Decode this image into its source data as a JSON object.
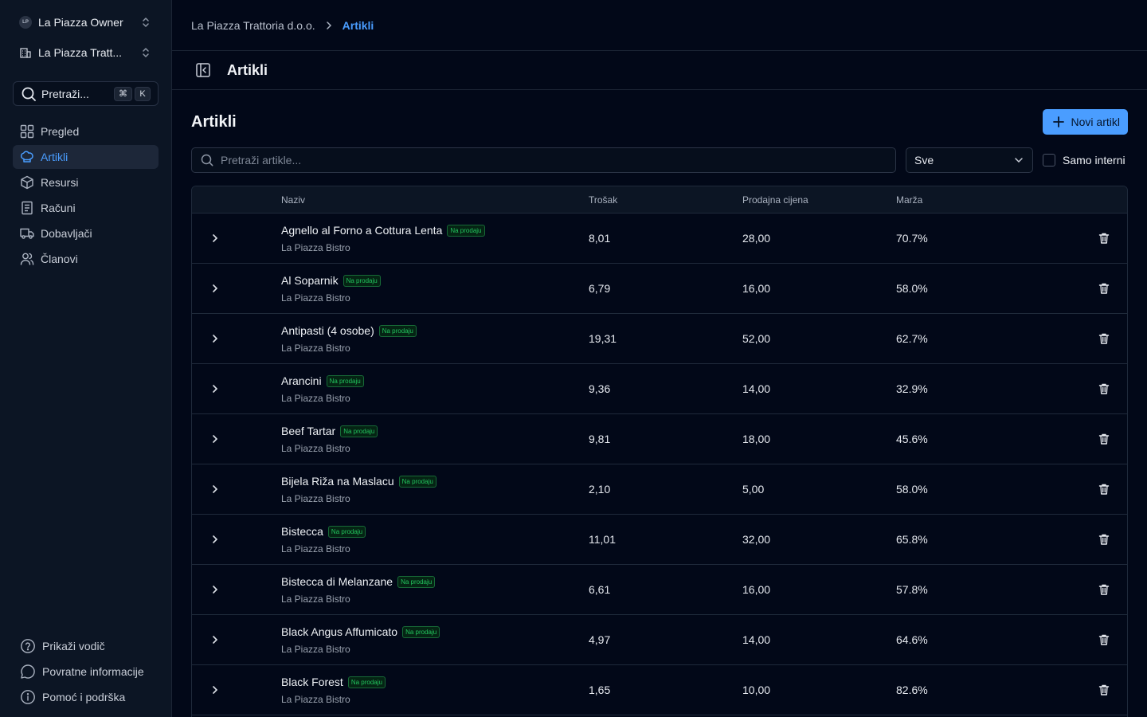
{
  "sidebar": {
    "org_switcher": {
      "badge": "LP",
      "label": "La Piazza Owner"
    },
    "location_switcher": {
      "label": "La Piazza Tratt..."
    },
    "search": {
      "label": "Pretraži...",
      "kbd_modifier": "⌘",
      "kbd_key": "K"
    },
    "nav": [
      {
        "label": "Pregled",
        "icon": "dashboard-icon"
      },
      {
        "label": "Artikli",
        "icon": "chef-hat-icon",
        "active": true
      },
      {
        "label": "Resursi",
        "icon": "box-icon"
      },
      {
        "label": "Računi",
        "icon": "receipt-icon"
      },
      {
        "label": "Dobavljači",
        "icon": "truck-icon"
      },
      {
        "label": "Članovi",
        "icon": "users-icon"
      }
    ],
    "bottom": [
      {
        "label": "Prikaži vodič",
        "icon": "help-circle-icon"
      },
      {
        "label": "Povratne informacije",
        "icon": "message-circle-icon"
      },
      {
        "label": "Pomoć i podrška",
        "icon": "info-icon"
      }
    ]
  },
  "breadcrumb": {
    "parent": "La Piazza Trattoria d.o.o.",
    "current": "Artikli"
  },
  "header": {
    "title": "Artikli"
  },
  "page": {
    "heading": "Artikli",
    "new_button": "Novi artikl",
    "search_placeholder": "Pretraži artikle...",
    "filter_value": "Sve",
    "internal_label": "Samo interni"
  },
  "table": {
    "columns": [
      "Naziv",
      "Trošak",
      "Prodajna cijena",
      "Marža"
    ],
    "rows": [
      {
        "name": "Agnello al Forno a Cottura Lenta",
        "badge": "Na prodaju",
        "location": "La Piazza Bistro",
        "cost": "8,01",
        "price": "28,00",
        "margin": "70.7%"
      },
      {
        "name": "Al Soparnik",
        "badge": "Na prodaju",
        "location": "La Piazza Bistro",
        "cost": "6,79",
        "price": "16,00",
        "margin": "58.0%"
      },
      {
        "name": "Antipasti (4 osobe)",
        "badge": "Na prodaju",
        "location": "La Piazza Bistro",
        "cost": "19,31",
        "price": "52,00",
        "margin": "62.7%"
      },
      {
        "name": "Arancini",
        "badge": "Na prodaju",
        "location": "La Piazza Bistro",
        "cost": "9,36",
        "price": "14,00",
        "margin": "32.9%"
      },
      {
        "name": "Beef Tartar",
        "badge": "Na prodaju",
        "location": "La Piazza Bistro",
        "cost": "9,81",
        "price": "18,00",
        "margin": "45.6%"
      },
      {
        "name": "Bijela Riža na Maslacu",
        "badge": "Na prodaju",
        "location": "La Piazza Bistro",
        "cost": "2,10",
        "price": "5,00",
        "margin": "58.0%"
      },
      {
        "name": "Bistecca",
        "badge": "Na prodaju",
        "location": "La Piazza Bistro",
        "cost": "11,01",
        "price": "32,00",
        "margin": "65.8%"
      },
      {
        "name": "Bistecca di Melanzane",
        "badge": "Na prodaju",
        "location": "La Piazza Bistro",
        "cost": "6,61",
        "price": "16,00",
        "margin": "57.8%"
      },
      {
        "name": "Black Angus Affumicato",
        "badge": "Na prodaju",
        "location": "La Piazza Bistro",
        "cost": "4,97",
        "price": "14,00",
        "margin": "64.6%"
      },
      {
        "name": "Black Forest",
        "badge": "Na prodaju",
        "location": "La Piazza Bistro",
        "cost": "1,65",
        "price": "10,00",
        "margin": "82.6%"
      }
    ]
  },
  "colors": {
    "accent": "#4a9dff",
    "background": "#020818",
    "sidebar": "#0c1524",
    "badge_green": "#22c55e"
  }
}
